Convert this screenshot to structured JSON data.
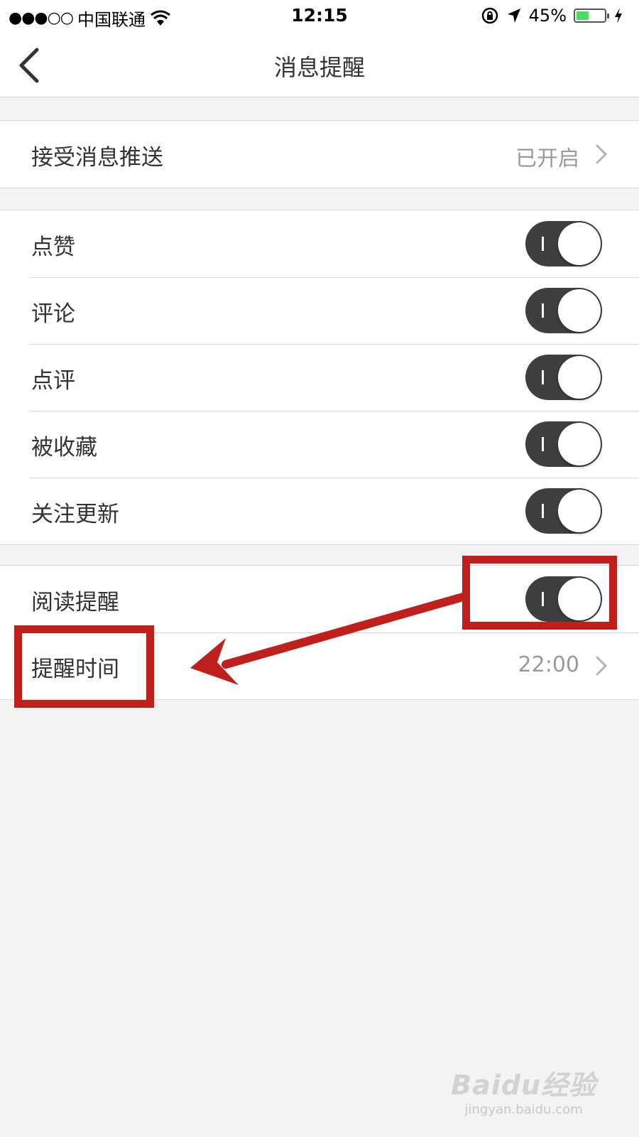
{
  "status_bar": {
    "signal": "●●●○○",
    "carrier": "中国联通",
    "time": "12:15",
    "battery_percent": "45%",
    "battery_level": 0.45,
    "battery_color": "#4cd964",
    "icons": [
      "wifi-icon",
      "orientation-lock-icon",
      "location-arrow-icon",
      "battery-icon",
      "charging-bolt-icon"
    ]
  },
  "nav": {
    "title": "消息提醒",
    "back_icon": "chevron-left-icon"
  },
  "push_group": {
    "label": "接受消息推送",
    "value": "已开启"
  },
  "notification_group": {
    "items": [
      {
        "label": "点赞",
        "on": true
      },
      {
        "label": "评论",
        "on": true
      },
      {
        "label": "点评",
        "on": true
      },
      {
        "label": "被收藏",
        "on": true
      },
      {
        "label": "关注更新",
        "on": true
      }
    ]
  },
  "reading_group": {
    "toggle_label": "阅读提醒",
    "toggle_on": true,
    "time_label": "提醒时间",
    "time_value": "22:00"
  },
  "colors": {
    "toggle_on": "#3f3f3f",
    "annotation": "#c0201b",
    "background": "#f3f3f3"
  },
  "watermark": {
    "logo": "Baidu经验",
    "url": "jingyan.baidu.com"
  }
}
